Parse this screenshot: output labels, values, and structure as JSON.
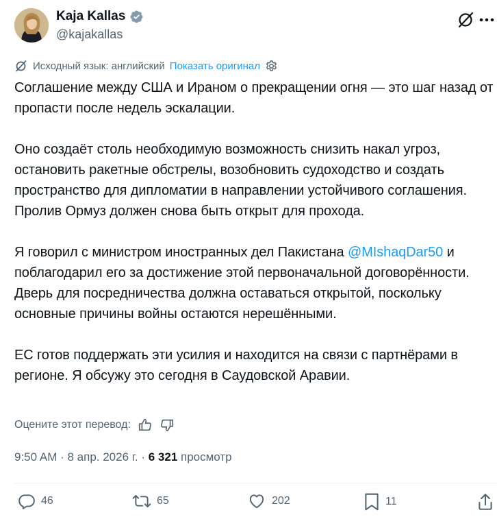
{
  "author": {
    "display_name": "Kaja Kallas",
    "handle": "@kajakallas",
    "avatar": "avatar-photo"
  },
  "translation": {
    "source_label": "Исходный язык: английский",
    "show_original": "Показать оригинал"
  },
  "tweet": {
    "p1": "Соглашение между США и Ираном о прекращении огня — это шаг назад от пропасти после недель эскалации.",
    "p2": "Оно создаёт столь необходимую возможность снизить накал угроз, остановить ракетные обстрелы, возобновить судоходство и создать пространство для дипломатии в направлении устойчивого соглашения. Пролив Ормуз должен снова быть открыт для прохода.",
    "p3_before": "Я говорил с министром иностранных дел Пакистана ",
    "p3_mention": "@MIshaqDar50",
    "p3_after": " и поблагодарил его за достижение этой первоначальной договорённости. Дверь для посредничества должна оставаться открытой, поскольку основные причины войны остаются нерешёнными.",
    "p4": "ЕС готов поддержать эти усилия и находится на связи с партнёрами в регионе. Я обсужу это сегодня в Саудовской Аравии."
  },
  "rate": {
    "label": "Оцените этот перевод:"
  },
  "meta": {
    "time": "9:50 AM",
    "sep1": " · ",
    "date": "8 апр. 2026 г.",
    "sep2": " · ",
    "views_count": "6 321",
    "views_label": " просмотр"
  },
  "actions": {
    "replies": "46",
    "reposts": "65",
    "likes": "202",
    "bookmarks": "11"
  },
  "colors": {
    "accent": "#1d9bf0",
    "text": "#0f1419",
    "secondary": "#536471"
  }
}
